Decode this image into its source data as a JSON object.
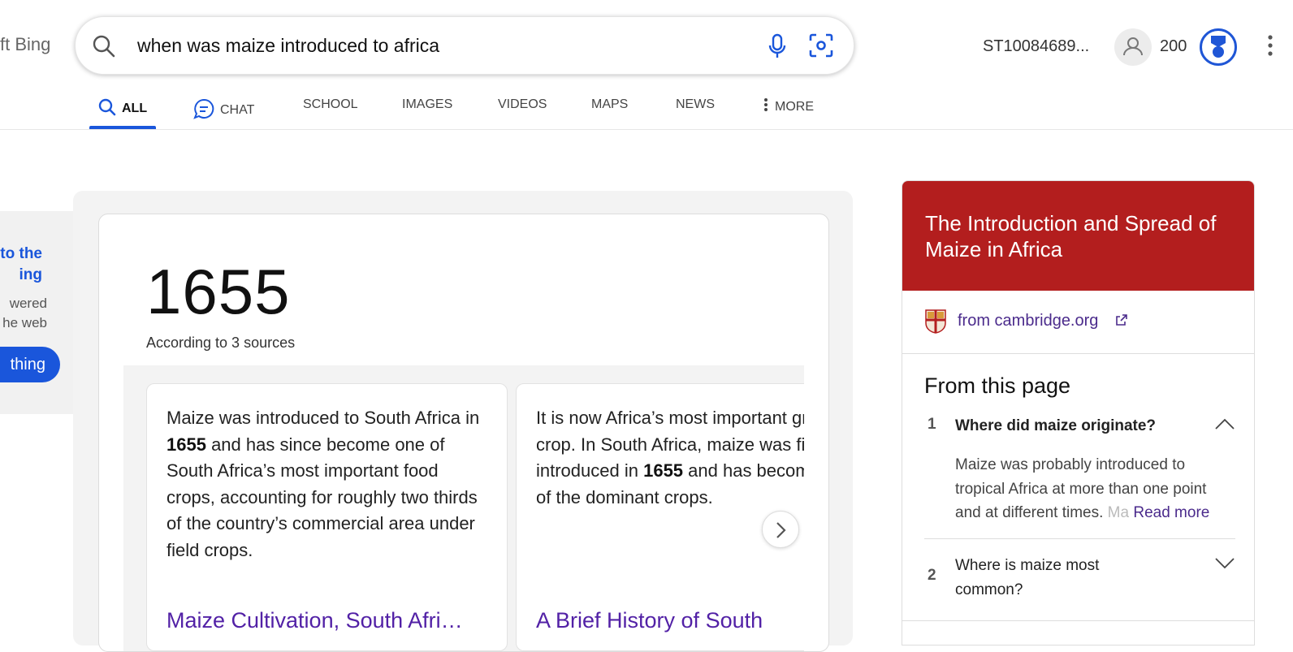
{
  "header": {
    "brand_fragment": "ft Bing",
    "search_query": "when was maize introduced to africa",
    "user_id": "ST10084689...",
    "points": "200"
  },
  "tabs": [
    {
      "label": "ALL",
      "active": true,
      "icon": "search-icon"
    },
    {
      "label": "CHAT",
      "active": false,
      "icon": "chat-icon"
    },
    {
      "label": "SCHOOL",
      "active": false
    },
    {
      "label": "IMAGES",
      "active": false
    },
    {
      "label": "VIDEOS",
      "active": false
    },
    {
      "label": "MAPS",
      "active": false
    },
    {
      "label": "NEWS",
      "active": false
    },
    {
      "label": "MORE",
      "active": false,
      "icon": "more-vertical-icon"
    }
  ],
  "promo": {
    "title_line1": "to the",
    "title_line2": "ing",
    "desc_line1": "wered",
    "desc_line2": "he web",
    "button": "thing"
  },
  "answer": {
    "value": "1655",
    "sources_text": "According to 3 sources",
    "cards": [
      {
        "text_before": "Maize was introduced to South Africa in ",
        "bold": "1655",
        "text_after": " and has since become one of South Africa’s most important food crops, accounting for roughly two thirds of the country’s commercial area under field crops.",
        "link": "Maize Cultivation, South Afri…"
      },
      {
        "text_before": "It is now Africa’s most important grain crop. In South Africa, maize was first introduced in ",
        "bold": "1655",
        "text_after": " and has become one of the dominant crops.",
        "link": "A Brief History of South"
      }
    ]
  },
  "right_panel": {
    "title": "The Introduction and Spread of Maize in Africa",
    "source": "from cambridge.org",
    "section_header": "From this page",
    "questions": [
      {
        "num": "1",
        "question": "Where did maize originate?",
        "answer": "Maize was probably introduced to tropical Africa at more than one point and at different times.",
        "answer_fade": "Ma",
        "read_more": "Read more",
        "expanded": true
      },
      {
        "num": "2",
        "question": "Where is maize most common?",
        "expanded": false
      }
    ]
  },
  "colors": {
    "accent": "#1a56db",
    "panel_header": "#b31e1e",
    "visited_link": "#5221a6"
  }
}
